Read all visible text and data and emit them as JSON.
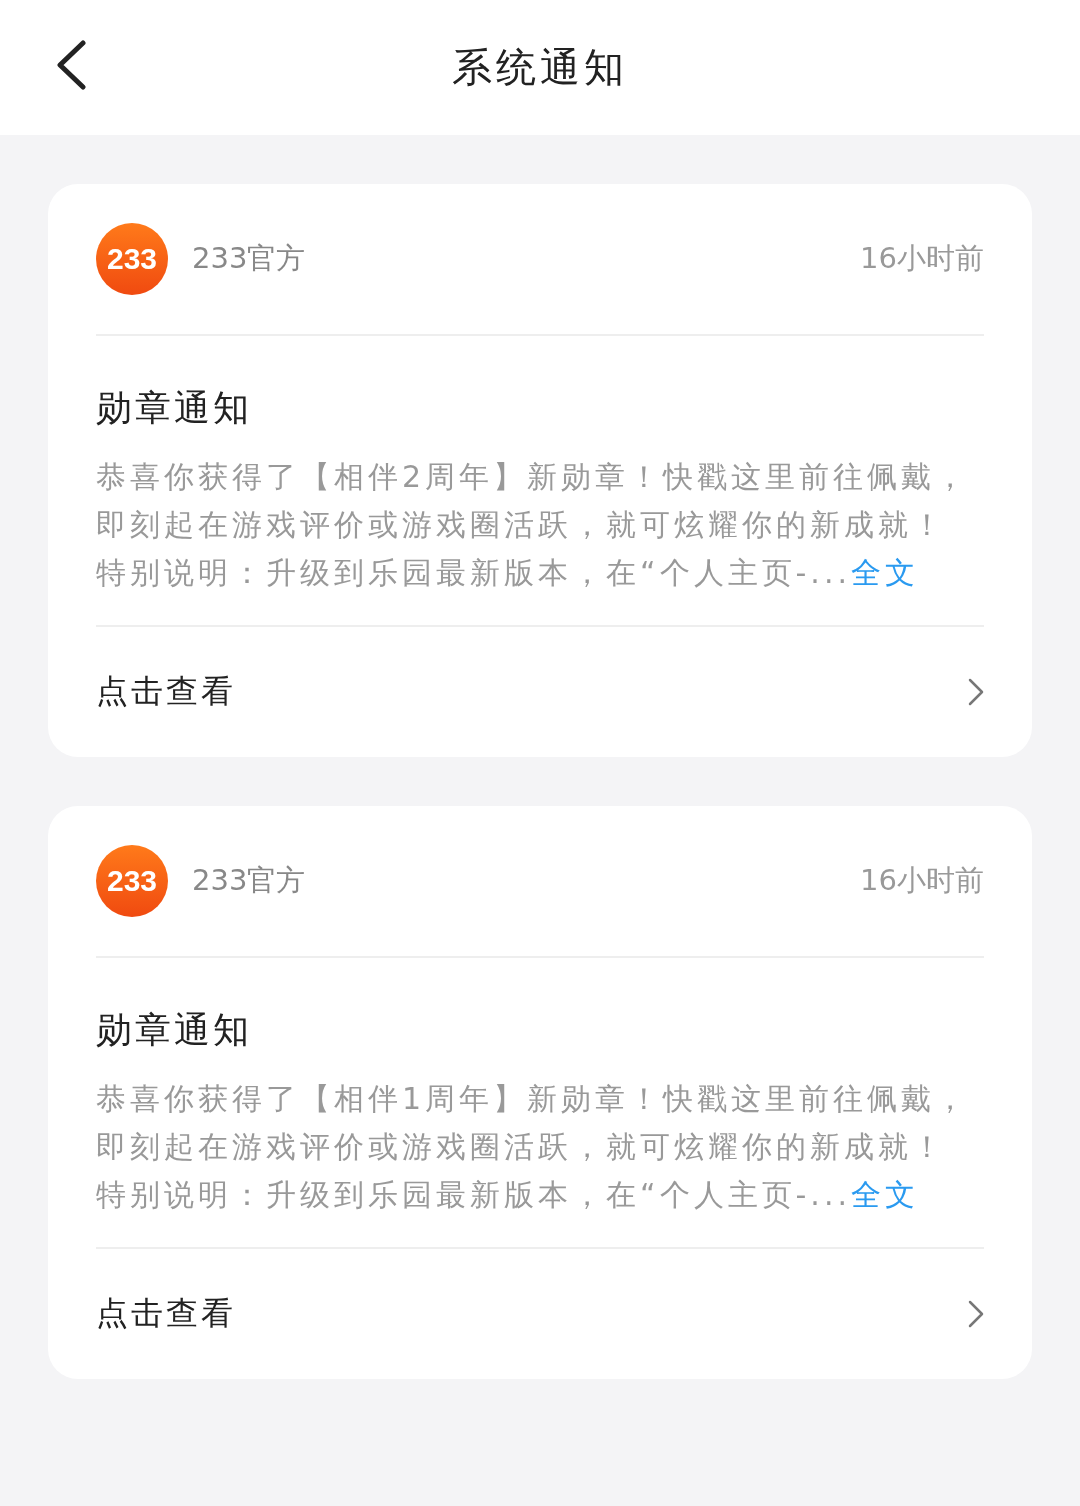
{
  "header": {
    "title": "系统通知"
  },
  "notifications": [
    {
      "logo_text": "233",
      "sender": "233官方",
      "time": "16小时前",
      "title": "勋章通知",
      "body": "恭喜你获得了【相伴2周年】新勋章！快戳这里前往佩戴，即刻起在游戏评价或游戏圈活跃，就可炫耀你的新成就！",
      "note": "特别说明：升级到乐园最新版本，在“个人主页-...",
      "link": "全文",
      "action": "点击查看"
    },
    {
      "logo_text": "233",
      "sender": "233官方",
      "time": "16小时前",
      "title": "勋章通知",
      "body": "恭喜你获得了【相伴1周年】新勋章！快戳这里前往佩戴，即刻起在游戏评价或游戏圈活跃，就可炫耀你的新成就！",
      "note": "特别说明：升级到乐园最新版本，在“个人主页-...",
      "link": "全文",
      "action": "点击查看"
    }
  ]
}
